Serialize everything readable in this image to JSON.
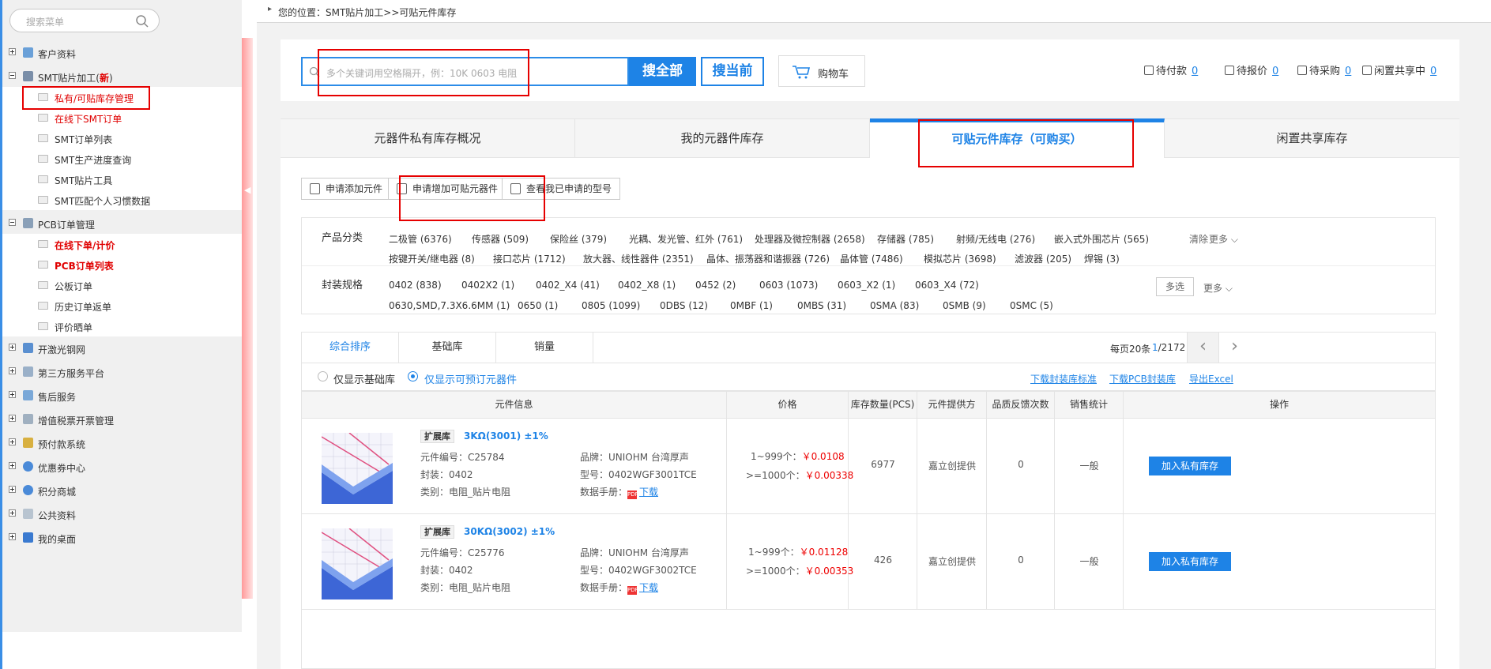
{
  "breadcrumb": "您的位置：SMT贴片加工>>可贴元件库存",
  "sidebar": {
    "search_placeholder": "搜索菜单",
    "items": [
      {
        "label": "客户资料"
      },
      {
        "label": "SMT贴片加工(",
        "badge": "新",
        "badge_close": ")"
      },
      {
        "label": "私有/可贴库存管理"
      },
      {
        "label": "在线下SMT订单"
      },
      {
        "label": "SMT订单列表"
      },
      {
        "label": "SMT生产进度查询"
      },
      {
        "label": "SMT贴片工具"
      },
      {
        "label": "SMT匹配个人习惯数据"
      },
      {
        "label": "PCB订单管理"
      },
      {
        "label": "在线下单/计价"
      },
      {
        "label": "PCB订单列表"
      },
      {
        "label": "公板订单"
      },
      {
        "label": "历史订单返单"
      },
      {
        "label": "评价晒单"
      },
      {
        "label": "开激光钢网"
      },
      {
        "label": "第三方服务平台"
      },
      {
        "label": "售后服务"
      },
      {
        "label": "增值税票开票管理"
      },
      {
        "label": "预付款系统"
      },
      {
        "label": "优惠券中心"
      },
      {
        "label": "积分商城"
      },
      {
        "label": "公共资料"
      },
      {
        "label": "我的桌面"
      }
    ]
  },
  "search": {
    "placeholder": "多个关键词用空格隔开，例：10K 0603 电阻",
    "btn_all": "搜全部",
    "btn_current": "搜当前",
    "cart": "购物车"
  },
  "stats": [
    {
      "label": "待付款",
      "count": "0"
    },
    {
      "label": "待报价",
      "count": "0"
    },
    {
      "label": "待采购",
      "count": "0"
    },
    {
      "label": "闲置共享中",
      "count": "0"
    }
  ],
  "tabs": [
    "元器件私有库存概况",
    "我的元器件库存",
    "可贴元件库存（可购买）",
    "闲置共享库存"
  ],
  "actions": [
    "申请添加元件",
    "申请增加可贴元器件",
    "查看我已申请的型号"
  ],
  "filters": {
    "category_label": "产品分类",
    "categories_row1": [
      "二极管 (6376)",
      "传感器 (509)",
      "保险丝 (379)",
      "光耦、发光管、红外 (761)",
      "处理器及微控制器 (2658)",
      "存储器 (785)",
      "射频/无线电 (276)",
      "嵌入式外围芯片 (565)"
    ],
    "categories_row2": [
      "按键开关/继电器 (8)",
      "接口芯片 (1712)",
      "放大器、线性器件 (2351)",
      "晶体、振荡器和谐振器 (726)",
      "晶体管 (7486)",
      "模拟芯片 (3698)",
      "滤波器 (205)",
      "焊锡 (3)"
    ],
    "clear": "清除",
    "more": "更多",
    "package_label": "封装规格",
    "packages_row1": [
      "0402 (838)",
      "0402X2 (1)",
      "0402_X4 (41)",
      "0402_X8 (1)",
      "0452 (2)",
      "0603 (1073)",
      "0603_X2 (1)",
      "0603_X4 (72)"
    ],
    "packages_row2": [
      "0630,SMD,7.3X6.6MM (1)",
      "0650 (1)",
      "0805 (1099)",
      "0DBS (12)",
      "0MBF (1)",
      "0MBS (31)",
      "0SMA (83)",
      "0SMB (9)",
      "0SMC (5)"
    ],
    "multi": "多选"
  },
  "sort": {
    "tabs": [
      "综合排序",
      "基础库",
      "销量"
    ],
    "per_page": "每页20条",
    "page_current": "1",
    "page_total": "/2172"
  },
  "options": {
    "only_basic": "仅显示基础库",
    "only_orderable": "仅显示可预订元器件",
    "links": [
      "下载封装库标准",
      "下载PCB封装库",
      "导出Excel"
    ]
  },
  "table": {
    "headers": [
      "元件信息",
      "价格",
      "库存数量(PCS)",
      "元件提供方",
      "品质反馈次数",
      "销售统计",
      "操作"
    ],
    "rows": [
      {
        "tag": "扩展库",
        "name": "3KΩ(3001) ±1%",
        "code": "元件编号：C25784",
        "brand": "品牌：UNIOHM 台湾厚声",
        "package": "封装：0402",
        "model": "型号：0402WGF3001TCE",
        "category": "类别：电阻_贴片电阻",
        "datasheet": "数据手册：",
        "download": "下载",
        "price1_label": "1~999个：",
        "price1": "￥0.0108",
        "price2_label": ">=1000个：",
        "price2": "￥0.00338",
        "stock": "6977",
        "provider": "嘉立创提供",
        "feedback": "0",
        "sales": "一般",
        "action": "加入私有库存"
      },
      {
        "tag": "扩展库",
        "name": "30KΩ(3002) ±1%",
        "code": "元件编号：C25776",
        "brand": "品牌：UNIOHM 台湾厚声",
        "package": "封装：0402",
        "model": "型号：0402WGF3002TCE",
        "category": "类别：电阻_贴片电阻",
        "datasheet": "数据手册：",
        "download": "下载",
        "price1_label": "1~999个：",
        "price1": "￥0.01128",
        "price2_label": ">=1000个：",
        "price2": "￥0.00353",
        "stock": "426",
        "provider": "嘉立创提供",
        "feedback": "0",
        "sales": "一般",
        "action": "加入私有库存"
      }
    ]
  },
  "colors": {
    "accent": "#1e83e6",
    "highlight": "#e60000",
    "price": "#e00000"
  }
}
